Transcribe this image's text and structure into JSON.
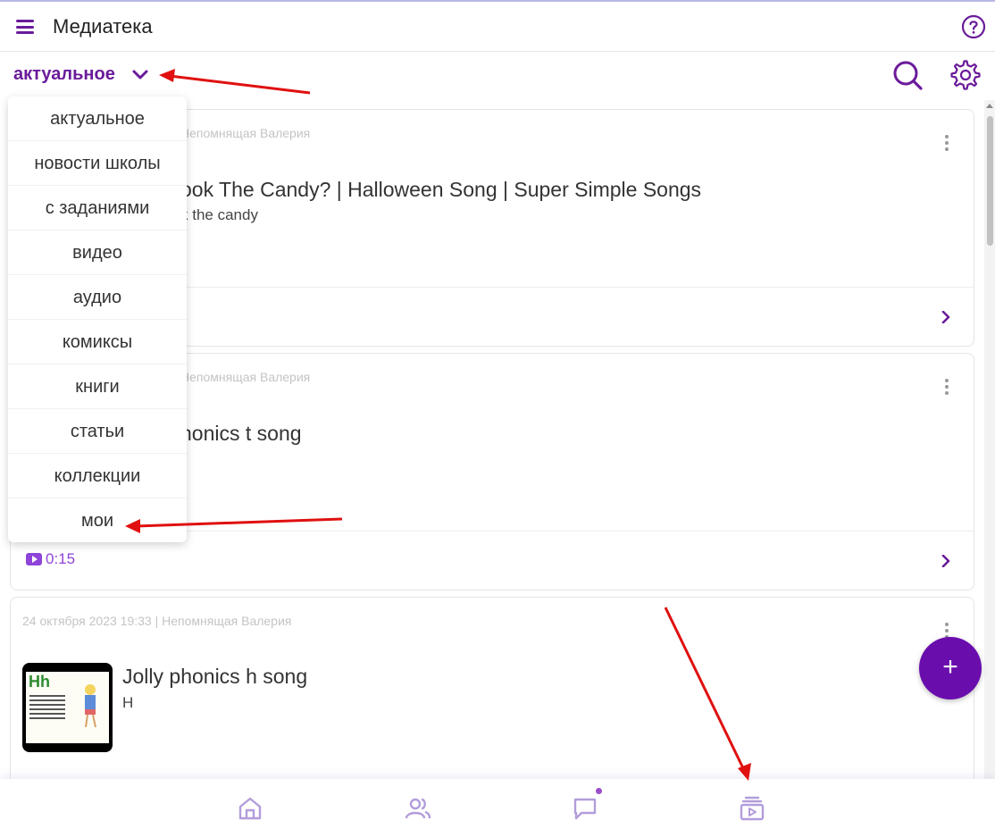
{
  "app": {
    "title": "Медиатека"
  },
  "filter": {
    "selected": "актуальное"
  },
  "dropdown": {
    "items": [
      "актуальное",
      "новости школы",
      "с заданиями",
      "видео",
      "аудио",
      "комиксы",
      "книги",
      "статьи",
      "коллекции",
      "мои"
    ]
  },
  "cards": [
    {
      "meta": "Непомнящая Валерия",
      "title": "ook The Candy? | Halloween Song | Super Simple Songs",
      "subtitle": "k the candy",
      "duration": ""
    },
    {
      "meta": "Непомнящая Валерия",
      "title": "honics t song",
      "subtitle": "",
      "duration": "0:15"
    },
    {
      "meta": "24 октября 2023 19:33 | Непомнящая Валерия",
      "title": "Jolly phonics h song",
      "subtitle": "H",
      "duration": "",
      "thumbnail_letters": "Hh"
    }
  ],
  "fab": {
    "label": "+"
  },
  "bottom_nav": {
    "items": [
      "home-icon",
      "users-icon",
      "chat-icon",
      "media-library-icon"
    ]
  },
  "colors": {
    "accent": "#6a1b9a",
    "fab": "#6a0dad",
    "duration": "#8e44d8",
    "arrow": "#e01010"
  }
}
